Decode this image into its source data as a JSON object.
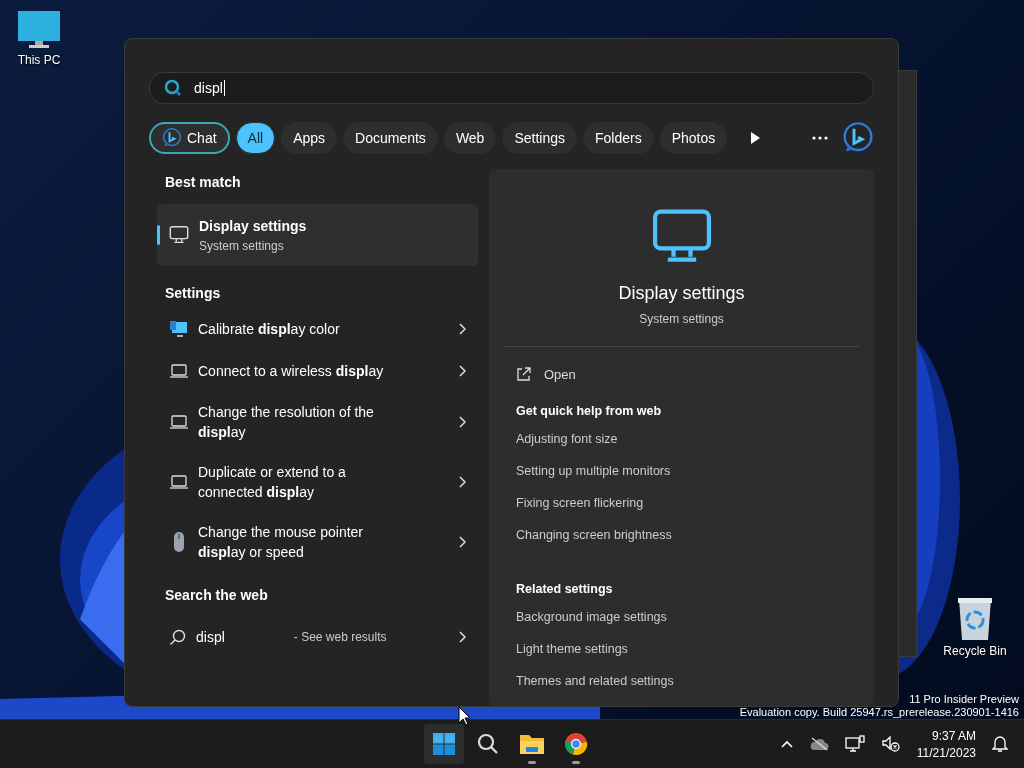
{
  "desktop": {
    "icons": [
      {
        "label": "This PC",
        "kind": "pc"
      },
      {
        "label": "Recycle Bin",
        "kind": "bin"
      }
    ],
    "watermark": [
      "11 Pro Insider Preview",
      "Evaluation copy. Build 25947.rs_prerelease.230901-1416"
    ]
  },
  "search": {
    "query": "displ",
    "filters": [
      {
        "label": "Chat",
        "kind": "chat",
        "selected": false
      },
      {
        "label": "All",
        "kind": "filter",
        "selected": true
      },
      {
        "label": "Apps",
        "kind": "filter",
        "selected": false
      },
      {
        "label": "Documents",
        "kind": "filter",
        "selected": false
      },
      {
        "label": "Web",
        "kind": "filter",
        "selected": false
      },
      {
        "label": "Settings",
        "kind": "filter",
        "selected": false
      },
      {
        "label": "Folders",
        "kind": "filter",
        "selected": false
      },
      {
        "label": "Photos",
        "kind": "filter",
        "selected": false
      }
    ],
    "best_match": {
      "heading": "Best match",
      "title": "Display settings",
      "subtitle": "System settings",
      "selected": true
    },
    "settings": {
      "heading": "Settings",
      "items": [
        {
          "text": "Calibrate **displ**ay color",
          "kind": "calibrate"
        },
        {
          "text": "Connect to a wireless **displ**ay",
          "kind": "laptop"
        },
        {
          "text": "Change the resolution of the **displ**ay",
          "kind": "laptop"
        },
        {
          "text": "Duplicate or extend to a connected **displ**ay",
          "kind": "laptop"
        },
        {
          "text": "Change the mouse pointer **displ**ay or speed",
          "kind": "mouse"
        }
      ]
    },
    "web": {
      "heading": "Search the web",
      "query": "displ",
      "suffix": "- See web results"
    },
    "preview": {
      "title": "Display settings",
      "subtitle": "System settings",
      "open": "Open",
      "sections": [
        {
          "heading": "Get quick help from web",
          "links": [
            "Adjusting font size",
            "Setting up multiple monitors",
            "Fixing screen flickering",
            "Changing screen brightness"
          ]
        },
        {
          "heading": "Related settings",
          "links": [
            "Background image settings",
            "Light theme settings",
            "Themes and related settings"
          ]
        }
      ]
    }
  },
  "taskbar": {
    "apps": [
      {
        "kind": "start",
        "selected": true,
        "running": false
      },
      {
        "kind": "search",
        "selected": false,
        "running": false
      },
      {
        "kind": "explorer",
        "selected": false,
        "running": true
      },
      {
        "kind": "chrome",
        "selected": false,
        "running": true
      }
    ],
    "time": "9:37 AM",
    "date": "11/21/2023"
  }
}
